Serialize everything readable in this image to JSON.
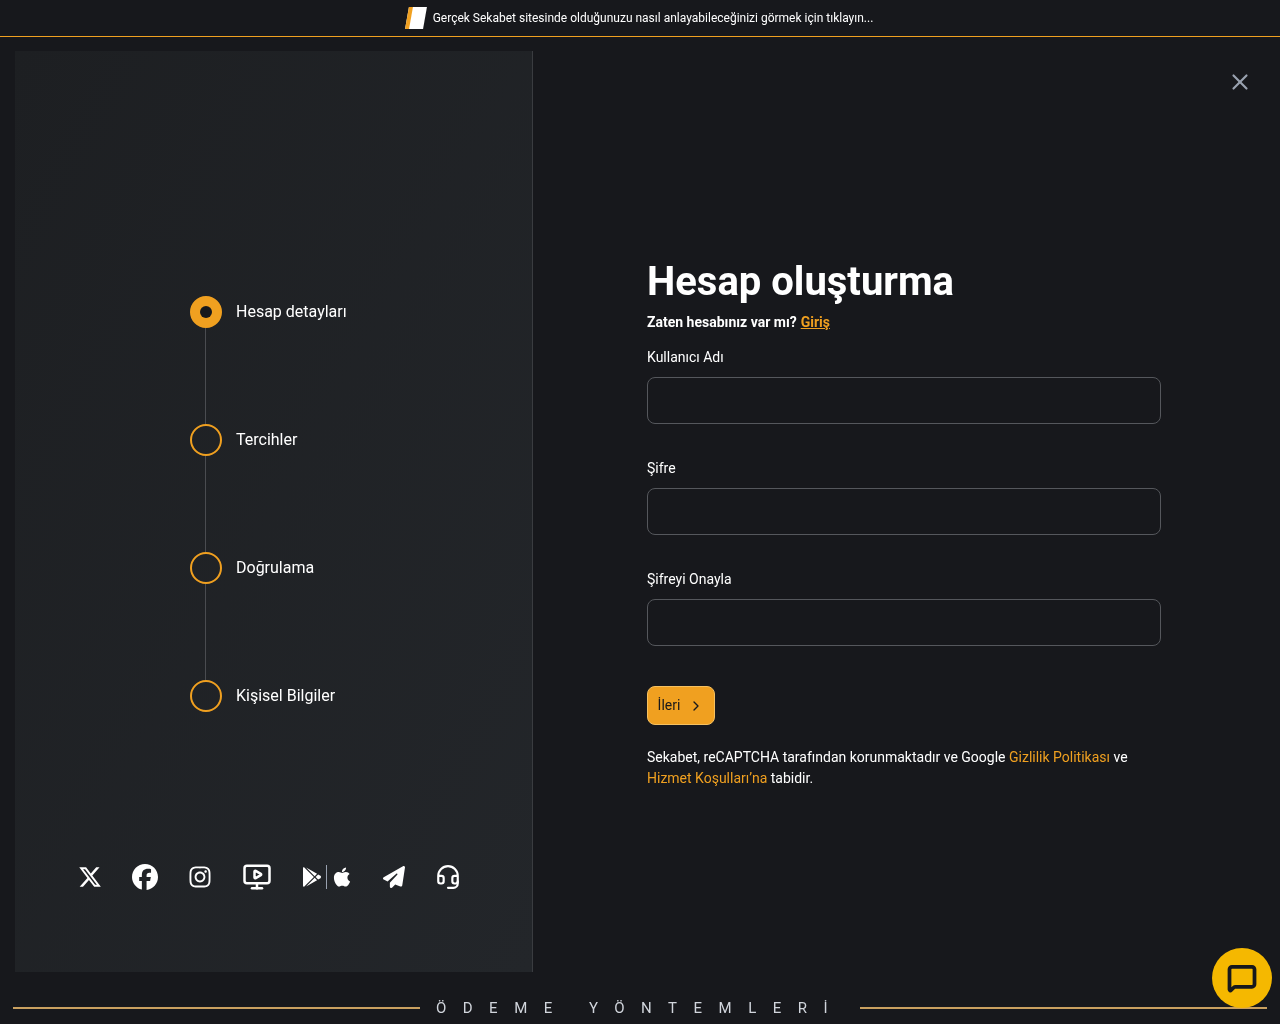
{
  "banner": {
    "text": "Gerçek Sekabet sitesinde olduğunuzu nasıl anlayabileceğinizi görmek için tıklayın..."
  },
  "steps": [
    {
      "label": "Hesap detayları",
      "selected": true
    },
    {
      "label": "Tercihler",
      "selected": false
    },
    {
      "label": "Doğrulama",
      "selected": false
    },
    {
      "label": "Kişisel Bilgiler",
      "selected": false
    }
  ],
  "social": [
    {
      "kind": "x"
    },
    {
      "kind": "facebook"
    },
    {
      "kind": "instagram"
    },
    {
      "kind": "video"
    },
    {
      "kind": "apps"
    },
    {
      "kind": "telegram"
    },
    {
      "kind": "support"
    }
  ],
  "form": {
    "title": "Hesap oluşturma",
    "login_prompt": {
      "text": "Zaten hesabınız var mı?",
      "link": "Giriş"
    },
    "fields": [
      {
        "label": "Kullanıcı Adı"
      },
      {
        "label": "Şifre"
      },
      {
        "label": "Şifreyi Onayla"
      }
    ],
    "next_button": "İleri",
    "notice": [
      {
        "kind": "text",
        "text": "Sekabet, reCAPTCHA tarafından korunmaktadır ve Google "
      },
      {
        "kind": "link",
        "text": "Gizlilik Politikası"
      },
      {
        "kind": "text",
        "text": " ve "
      },
      {
        "kind": "link",
        "text": "Hizmet Koşulları’na"
      },
      {
        "kind": "text",
        "text": " tabidir."
      }
    ]
  },
  "footer": {
    "title": "ÖDEME YÖNTEMLERİ"
  }
}
